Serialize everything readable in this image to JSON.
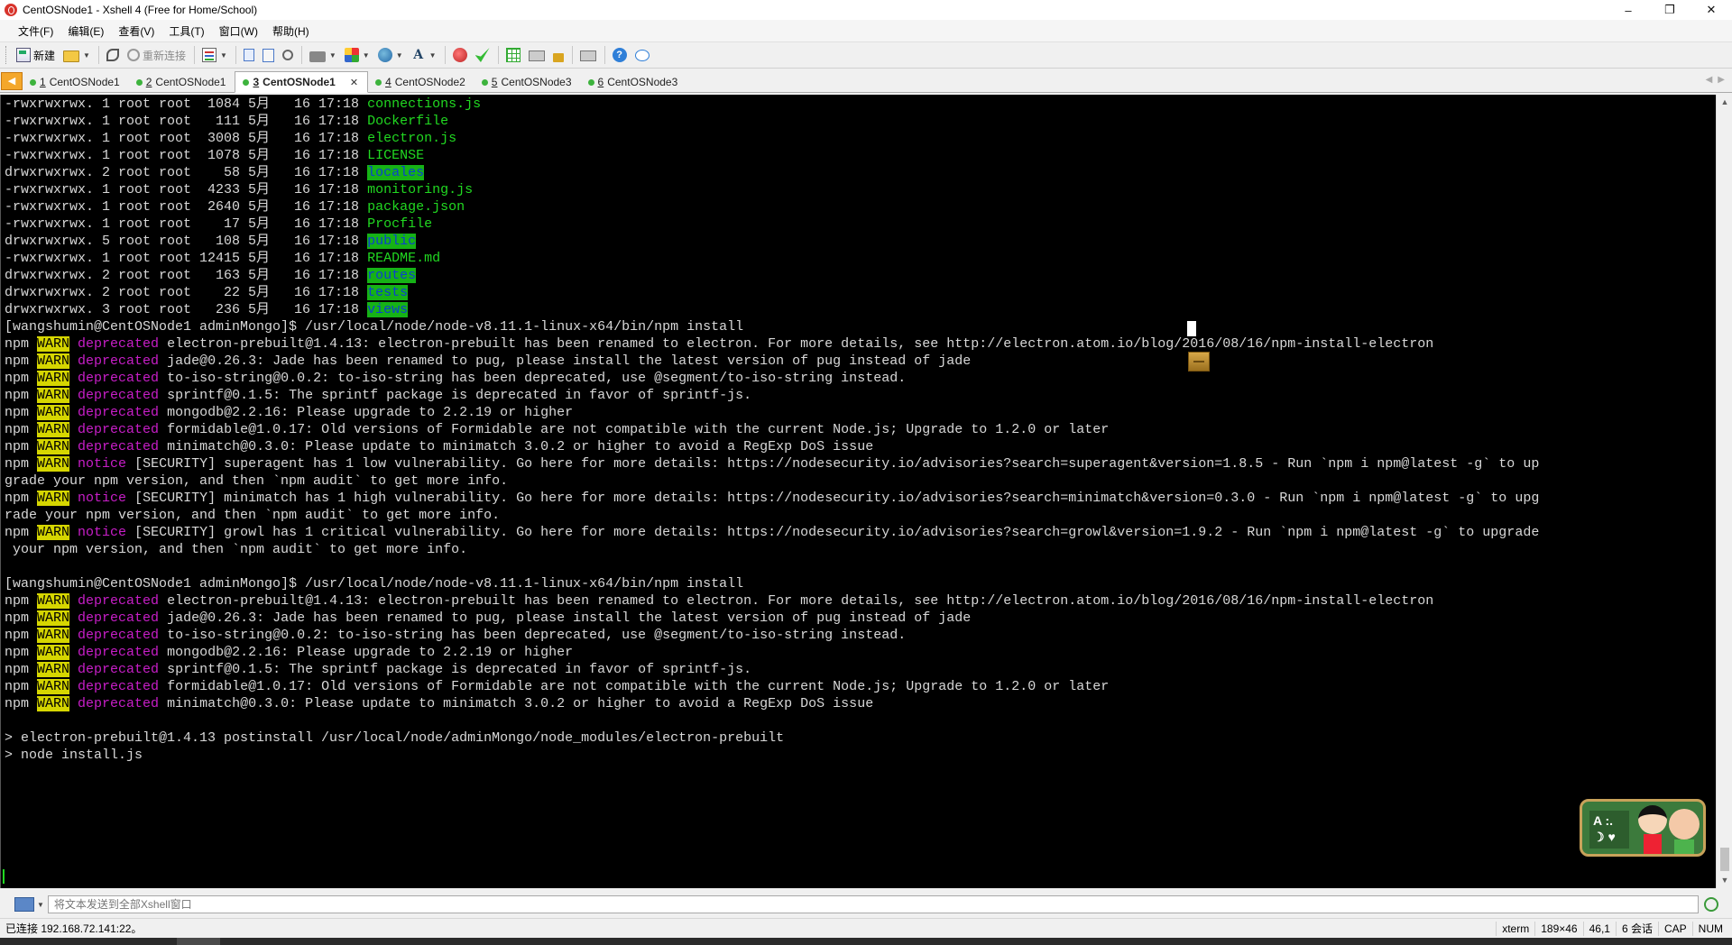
{
  "window": {
    "title": "CentOSNode1 - Xshell 4 (Free for Home/School)",
    "controls": [
      "–",
      "❐",
      "✕"
    ]
  },
  "menu": [
    "文件(F)",
    "编辑(E)",
    "查看(V)",
    "工具(T)",
    "窗口(W)",
    "帮助(H)"
  ],
  "toolbar": {
    "new_label": "新建",
    "reconnect_label": "重新连接"
  },
  "tabs": [
    {
      "number": "1",
      "label": "CentOSNode1",
      "active": false
    },
    {
      "number": "2",
      "label": "CentOSNode1",
      "active": false
    },
    {
      "number": "3",
      "label": "CentOSNode1",
      "active": true
    },
    {
      "number": "4",
      "label": "CentOSNode2",
      "active": false
    },
    {
      "number": "5",
      "label": "CentOSNode3",
      "active": false
    },
    {
      "number": "6",
      "label": "CentOSNode3",
      "active": false
    }
  ],
  "terminal": {
    "lines": [
      [
        [
          "-rwxrwxrwx. 1 root root  1084 5月   16 17:18 ",
          ""
        ],
        [
          "connections.js",
          "green"
        ]
      ],
      [
        [
          "-rwxrwxrwx. 1 root root   111 5月   16 17:18 ",
          ""
        ],
        [
          "Dockerfile",
          "green"
        ]
      ],
      [
        [
          "-rwxrwxrwx. 1 root root  3008 5月   16 17:18 ",
          ""
        ],
        [
          "electron.js",
          "green"
        ]
      ],
      [
        [
          "-rwxrwxrwx. 1 root root  1078 5月   16 17:18 ",
          ""
        ],
        [
          "LICENSE",
          "green"
        ]
      ],
      [
        [
          "drwxrwxrwx. 2 root root    58 5月   16 17:18 ",
          ""
        ],
        [
          "locales",
          "dirbg"
        ]
      ],
      [
        [
          "-rwxrwxrwx. 1 root root  4233 5月   16 17:18 ",
          ""
        ],
        [
          "monitoring.js",
          "green"
        ]
      ],
      [
        [
          "-rwxrwxrwx. 1 root root  2640 5月   16 17:18 ",
          ""
        ],
        [
          "package.json",
          "green"
        ]
      ],
      [
        [
          "-rwxrwxrwx. 1 root root    17 5月   16 17:18 ",
          ""
        ],
        [
          "Procfile",
          "green"
        ]
      ],
      [
        [
          "drwxrwxrwx. 5 root root   108 5月   16 17:18 ",
          ""
        ],
        [
          "public",
          "dirbg"
        ]
      ],
      [
        [
          "-rwxrwxrwx. 1 root root 12415 5月   16 17:18 ",
          ""
        ],
        [
          "README.md",
          "green"
        ]
      ],
      [
        [
          "drwxrwxrwx. 2 root root   163 5月   16 17:18 ",
          ""
        ],
        [
          "routes",
          "dirbg"
        ]
      ],
      [
        [
          "drwxrwxrwx. 2 root root    22 5月   16 17:18 ",
          ""
        ],
        [
          "tests",
          "dirbg"
        ]
      ],
      [
        [
          "drwxrwxrwx. 3 root root   236 5月   16 17:18 ",
          ""
        ],
        [
          "views",
          "dirbg"
        ]
      ],
      [
        [
          "[wangshumin@CentOSNode1 adminMongo]$ /usr/local/node/node-v8.11.1-linux-x64/bin/npm install",
          ""
        ]
      ],
      [
        [
          "npm ",
          ""
        ],
        [
          "WARN",
          "warn"
        ],
        [
          " ",
          ""
        ],
        [
          "deprecated",
          "magenta"
        ],
        [
          " electron-prebuilt@1.4.13: electron-prebuilt has been renamed to electron. For more details, see http://electron.atom.io/blog/2016/08/16/npm-install-electron",
          ""
        ]
      ],
      [
        [
          "npm ",
          ""
        ],
        [
          "WARN",
          "warn"
        ],
        [
          " ",
          ""
        ],
        [
          "deprecated",
          "magenta"
        ],
        [
          " jade@0.26.3: Jade has been renamed to pug, please install the latest version of pug instead of jade",
          ""
        ]
      ],
      [
        [
          "npm ",
          ""
        ],
        [
          "WARN",
          "warn"
        ],
        [
          " ",
          ""
        ],
        [
          "deprecated",
          "magenta"
        ],
        [
          " to-iso-string@0.0.2: to-iso-string has been deprecated, use @segment/to-iso-string instead.",
          ""
        ]
      ],
      [
        [
          "npm ",
          ""
        ],
        [
          "WARN",
          "warn"
        ],
        [
          " ",
          ""
        ],
        [
          "deprecated",
          "magenta"
        ],
        [
          " sprintf@0.1.5: The sprintf package is deprecated in favor of sprintf-js.",
          ""
        ]
      ],
      [
        [
          "npm ",
          ""
        ],
        [
          "WARN",
          "warn"
        ],
        [
          " ",
          ""
        ],
        [
          "deprecated",
          "magenta"
        ],
        [
          " mongodb@2.2.16: Please upgrade to 2.2.19 or higher",
          ""
        ]
      ],
      [
        [
          "npm ",
          ""
        ],
        [
          "WARN",
          "warn"
        ],
        [
          " ",
          ""
        ],
        [
          "deprecated",
          "magenta"
        ],
        [
          " formidable@1.0.17: Old versions of Formidable are not compatible with the current Node.js; Upgrade to 1.2.0 or later",
          ""
        ]
      ],
      [
        [
          "npm ",
          ""
        ],
        [
          "WARN",
          "warn"
        ],
        [
          " ",
          ""
        ],
        [
          "deprecated",
          "magenta"
        ],
        [
          " minimatch@0.3.0: Please update to minimatch 3.0.2 or higher to avoid a RegExp DoS issue",
          ""
        ]
      ],
      [
        [
          "npm ",
          ""
        ],
        [
          "WARN",
          "warn"
        ],
        [
          " ",
          ""
        ],
        [
          "notice",
          "magenta"
        ],
        [
          " [SECURITY] superagent has 1 low vulnerability. Go here for more details: https://nodesecurity.io/advisories?search=superagent&version=1.8.5 - Run `npm i npm@latest -g` to up",
          ""
        ]
      ],
      [
        [
          "grade your npm version, and then `npm audit` to get more info.",
          ""
        ]
      ],
      [
        [
          "npm ",
          ""
        ],
        [
          "WARN",
          "warn"
        ],
        [
          " ",
          ""
        ],
        [
          "notice",
          "magenta"
        ],
        [
          " [SECURITY] minimatch has 1 high vulnerability. Go here for more details: https://nodesecurity.io/advisories?search=minimatch&version=0.3.0 - Run `npm i npm@latest -g` to upg",
          ""
        ]
      ],
      [
        [
          "rade your npm version, and then `npm audit` to get more info.",
          ""
        ]
      ],
      [
        [
          "npm ",
          ""
        ],
        [
          "WARN",
          "warn"
        ],
        [
          " ",
          ""
        ],
        [
          "notice",
          "magenta"
        ],
        [
          " [SECURITY] growl has 1 critical vulnerability. Go here for more details: https://nodesecurity.io/advisories?search=growl&version=1.9.2 - Run `npm i npm@latest -g` to upgrade",
          ""
        ]
      ],
      [
        [
          " your npm version, and then `npm audit` to get more info.",
          ""
        ]
      ],
      [
        [
          "",
          ""
        ]
      ],
      [
        [
          "[wangshumin@CentOSNode1 adminMongo]$ /usr/local/node/node-v8.11.1-linux-x64/bin/npm install",
          ""
        ]
      ],
      [
        [
          "npm ",
          ""
        ],
        [
          "WARN",
          "warn"
        ],
        [
          " ",
          ""
        ],
        [
          "deprecated",
          "magenta"
        ],
        [
          " electron-prebuilt@1.4.13: electron-prebuilt has been renamed to electron. For more details, see http://electron.atom.io/blog/2016/08/16/npm-install-electron",
          ""
        ]
      ],
      [
        [
          "npm ",
          ""
        ],
        [
          "WARN",
          "warn"
        ],
        [
          " ",
          ""
        ],
        [
          "deprecated",
          "magenta"
        ],
        [
          " jade@0.26.3: Jade has been renamed to pug, please install the latest version of pug instead of jade",
          ""
        ]
      ],
      [
        [
          "npm ",
          ""
        ],
        [
          "WARN",
          "warn"
        ],
        [
          " ",
          ""
        ],
        [
          "deprecated",
          "magenta"
        ],
        [
          " to-iso-string@0.0.2: to-iso-string has been deprecated, use @segment/to-iso-string instead.",
          ""
        ]
      ],
      [
        [
          "npm ",
          ""
        ],
        [
          "WARN",
          "warn"
        ],
        [
          " ",
          ""
        ],
        [
          "deprecated",
          "magenta"
        ],
        [
          " mongodb@2.2.16: Please upgrade to 2.2.19 or higher",
          ""
        ]
      ],
      [
        [
          "npm ",
          ""
        ],
        [
          "WARN",
          "warn"
        ],
        [
          " ",
          ""
        ],
        [
          "deprecated",
          "magenta"
        ],
        [
          " sprintf@0.1.5: The sprintf package is deprecated in favor of sprintf-js.",
          ""
        ]
      ],
      [
        [
          "npm ",
          ""
        ],
        [
          "WARN",
          "warn"
        ],
        [
          " ",
          ""
        ],
        [
          "deprecated",
          "magenta"
        ],
        [
          " formidable@1.0.17: Old versions of Formidable are not compatible with the current Node.js; Upgrade to 1.2.0 or later",
          ""
        ]
      ],
      [
        [
          "npm ",
          ""
        ],
        [
          "WARN",
          "warn"
        ],
        [
          " ",
          ""
        ],
        [
          "deprecated",
          "magenta"
        ],
        [
          " minimatch@0.3.0: Please update to minimatch 3.0.2 or higher to avoid a RegExp DoS issue",
          ""
        ]
      ],
      [
        [
          "",
          ""
        ]
      ],
      [
        [
          "> electron-prebuilt@1.4.13 postinstall /usr/local/node/adminMongo/node_modules/electron-prebuilt",
          ""
        ]
      ],
      [
        [
          "> node install.js",
          ""
        ]
      ]
    ],
    "colors": {
      "green": "#21d821",
      "dirbg": "#16b216",
      "warn": "#d6d600",
      "magenta": "#c81ec8",
      "background": "#000000"
    }
  },
  "sticker": {
    "board_text": "A :.\n☽ ♥"
  },
  "compose": {
    "placeholder": "将文本发送到全部Xshell窗口"
  },
  "status": {
    "connection": "已连接 192.168.72.141:22。",
    "term_type": "xterm",
    "size": "189×46",
    "cursor": "46,1",
    "sessions": "6 会话",
    "cap": "CAP",
    "num": "NUM"
  }
}
